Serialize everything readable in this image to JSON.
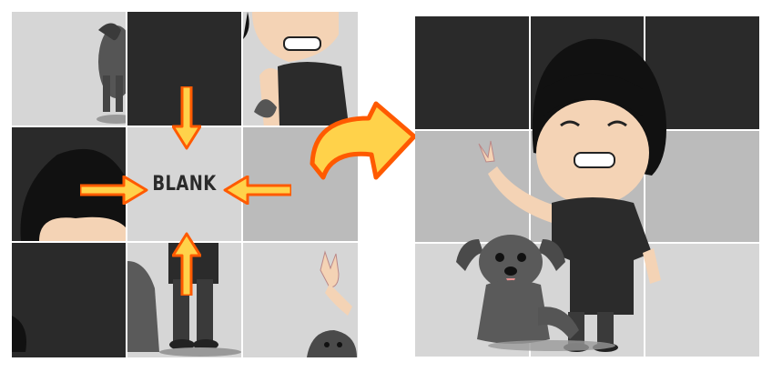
{
  "puzzle": {
    "blank_label": "BLANK"
  },
  "colors": {
    "dark_tile": "#2a2a2a",
    "light_tile": "#d6d6d6",
    "mid_tile": "#bbbbbb",
    "arrow_fill": "#ffd24a",
    "arrow_outline": "#ff5a00"
  },
  "scrambled_tiles": [
    {
      "row": 1,
      "col": 1,
      "content": "dog-tail-on-light"
    },
    {
      "row": 1,
      "col": 2,
      "content": "dark-blank-upper"
    },
    {
      "row": 1,
      "col": 3,
      "content": "boy-face-wave"
    },
    {
      "row": 2,
      "col": 1,
      "content": "boy-hair-dark"
    },
    {
      "row": 2,
      "col": 2,
      "content": "blank"
    },
    {
      "row": 2,
      "col": 3,
      "content": "mid-gray-empty"
    },
    {
      "row": 3,
      "col": 1,
      "content": "dark-corner-hair"
    },
    {
      "row": 3,
      "col": 2,
      "content": "boy-legs-dog"
    },
    {
      "row": 3,
      "col": 3,
      "content": "peace-hand-dog-head"
    }
  ],
  "icons": [
    "arrow-down-icon",
    "arrow-right-icon",
    "arrow-left-icon",
    "arrow-up-icon",
    "curved-arrow-icon"
  ]
}
